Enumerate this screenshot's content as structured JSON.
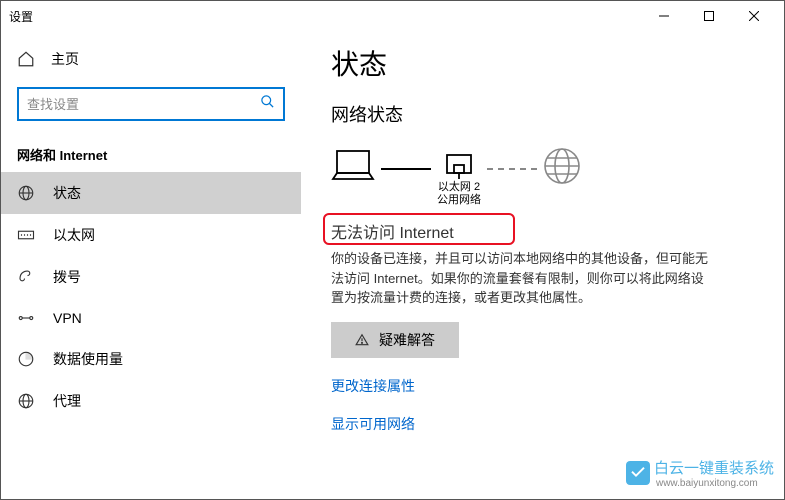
{
  "titlebar": {
    "title": "设置"
  },
  "sidebar": {
    "home_label": "主页",
    "search_placeholder": "查找设置",
    "section_header": "网络和 Internet",
    "items": [
      {
        "label": "状态"
      },
      {
        "label": "以太网"
      },
      {
        "label": "拨号"
      },
      {
        "label": "VPN"
      },
      {
        "label": "数据使用量"
      },
      {
        "label": "代理"
      }
    ]
  },
  "main": {
    "page_title": "状态",
    "section_title": "网络状态",
    "ethernet_label": "以太网 2",
    "network_type": "公用网络",
    "status_text": "无法访问 Internet",
    "status_desc": "你的设备已连接，并且可以访问本地网络中的其他设备，但可能无法访问 Internet。如果你的流量套餐有限制，则你可以将此网络设置为按流量计费的连接，或者更改其他属性。",
    "troubleshoot_label": "疑难解答",
    "link_change": "更改连接属性",
    "link_show": "显示可用网络"
  },
  "watermark": {
    "brand": "白云一键重装系统",
    "url": "www.baiyunxitong.com"
  }
}
